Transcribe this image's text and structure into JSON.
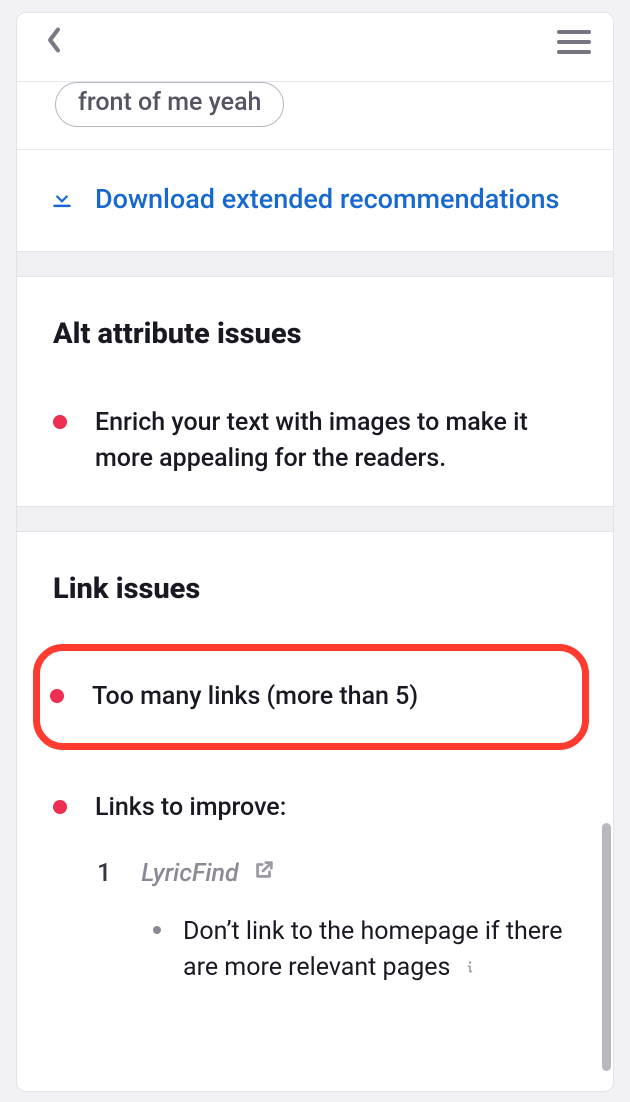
{
  "chip": {
    "partial_text": "front of me yeah"
  },
  "download": {
    "label": "Download extended recommendations"
  },
  "sections": {
    "alt": {
      "heading": "Alt attribute issues",
      "items": [
        "Enrich your text with images to make it more appealing for the readers."
      ]
    },
    "links": {
      "heading": "Link issues",
      "highlighted": "Too many links (more than 5)",
      "improve_label": "Links to improve:",
      "list": [
        {
          "index": "1",
          "name": "LyricFind",
          "tips": [
            "Don’t link to the homepage if there are more relevant pages"
          ]
        }
      ]
    }
  }
}
